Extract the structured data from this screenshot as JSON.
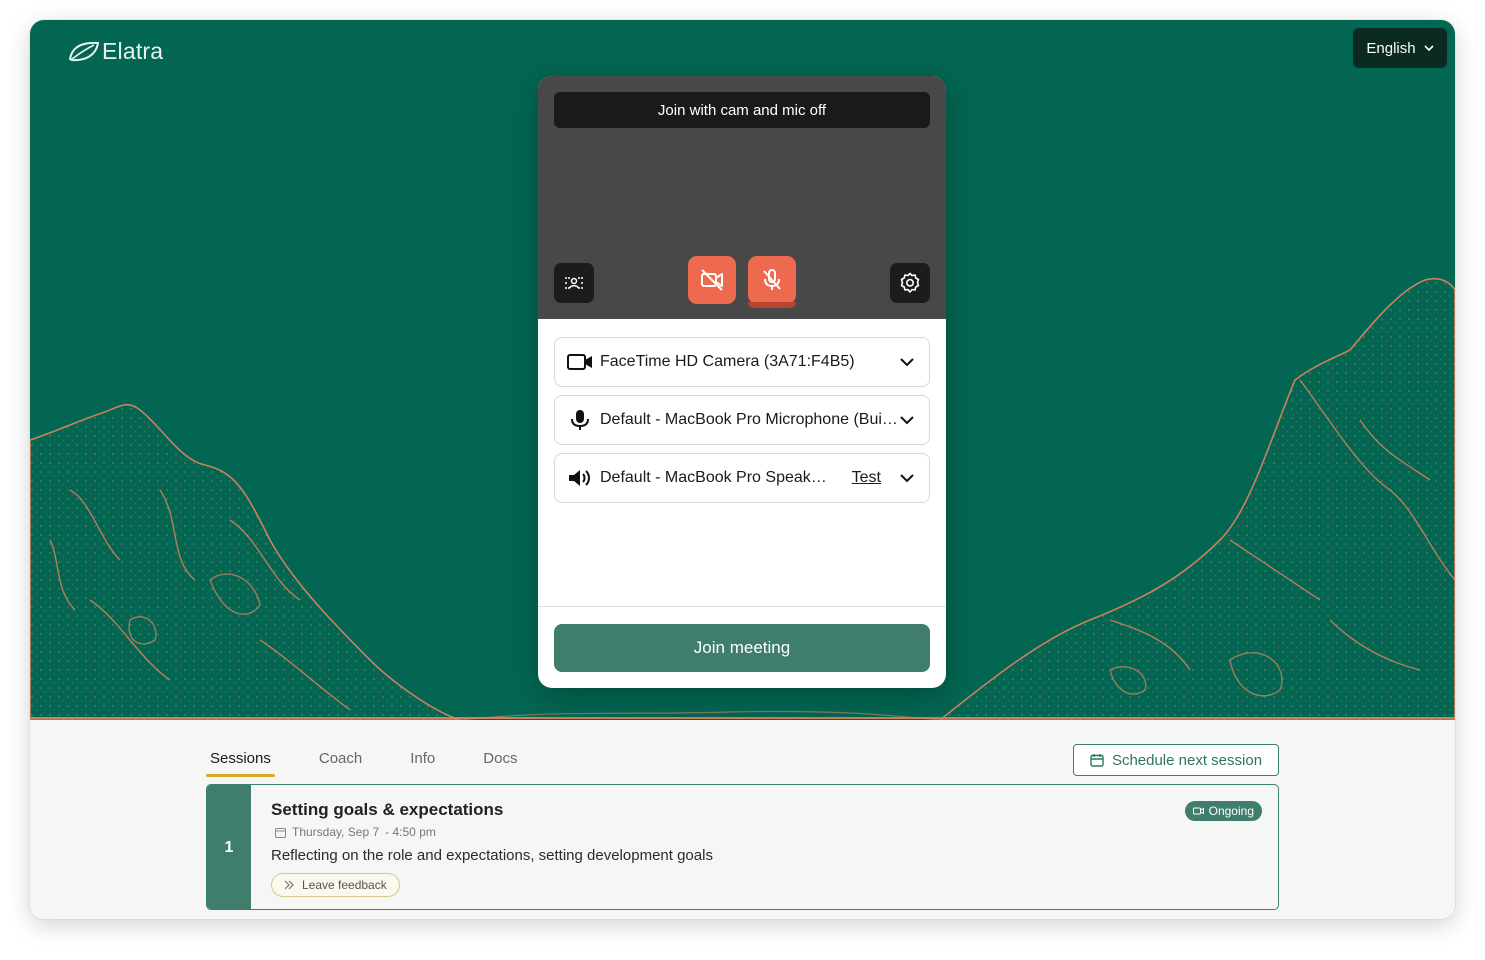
{
  "brand": {
    "name": "Elatra"
  },
  "header": {
    "language_label": "English"
  },
  "prejoin": {
    "join_cam_mic_off_label": "Join with cam and mic off",
    "devices": {
      "camera": "FaceTime HD Camera (3A71:F4B5)",
      "microphone": "Default - MacBook Pro Microphone (Built-in)",
      "speaker": "Default - MacBook Pro Speakers (Built-in)",
      "speaker_test_label": "Test"
    },
    "join_button_label": "Join meeting",
    "colors": {
      "muted_button": "#ee6a4f",
      "preview_bg": "#484848",
      "join_button": "#3f7e6c"
    }
  },
  "tabs": [
    {
      "label": "Sessions",
      "active": true
    },
    {
      "label": "Coach",
      "active": false
    },
    {
      "label": "Info",
      "active": false
    },
    {
      "label": "Docs",
      "active": false
    }
  ],
  "schedule_button_label": "Schedule next session",
  "sessions": [
    {
      "number": "1",
      "title": "Setting goals & expectations",
      "date": "Thursday, Sep 7",
      "time": "- 4:50 pm",
      "description": "Reflecting on the role and expectations, setting development goals",
      "feedback_label": "Leave feedback",
      "status": "Ongoing"
    }
  ],
  "theme": {
    "brand_green": "#036652",
    "accent_orange": "#e2845f",
    "tab_underline": "#d9a62a"
  }
}
